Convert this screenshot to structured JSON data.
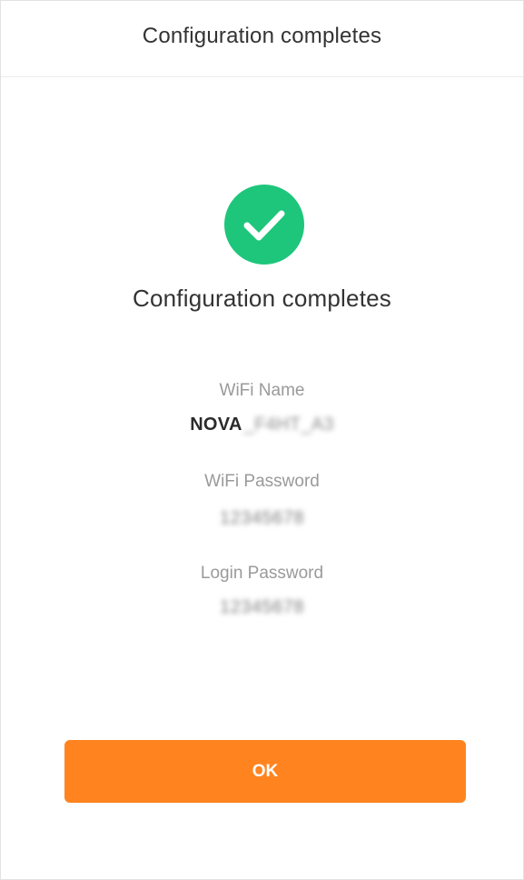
{
  "header": {
    "title": "Configuration completes"
  },
  "status": {
    "icon": "check-circle-icon",
    "title": "Configuration completes"
  },
  "details": {
    "wifi_name_label": "WiFi Name",
    "wifi_name_prefix": "NOVA",
    "wifi_name_suffix": "_F4HT_A3",
    "wifi_password_label": "WiFi Password",
    "wifi_password_value": "12345678",
    "login_password_label": "Login Password",
    "login_password_value": "12345678"
  },
  "actions": {
    "ok_label": "OK"
  },
  "colors": {
    "success": "#1ec67b",
    "primary_button": "#ff8420"
  }
}
